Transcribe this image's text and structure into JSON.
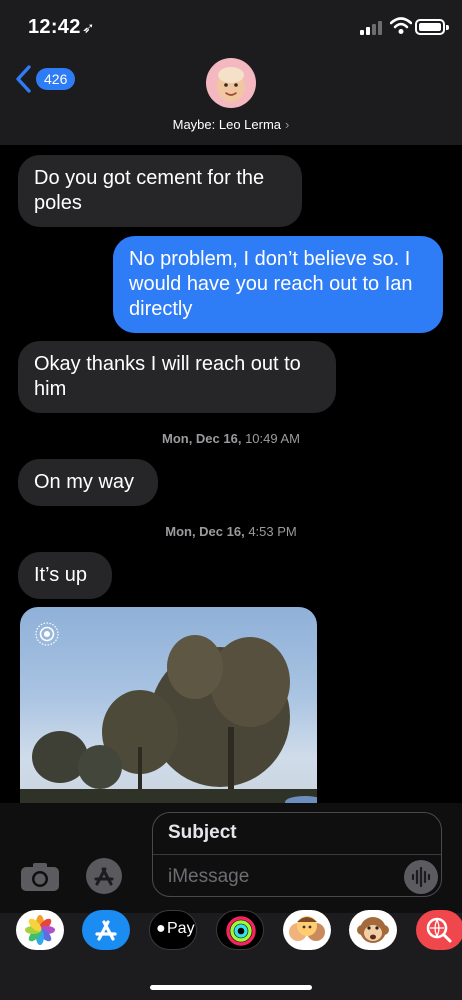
{
  "status_bar": {
    "time": "12:42"
  },
  "header": {
    "back_count": "426",
    "contact_name": "Maybe: Leo Lerma"
  },
  "messages": [
    {
      "direction": "incoming",
      "text": "Do you got cement for the poles"
    },
    {
      "direction": "outgoing",
      "text": "No problem, I don’t believe so. I would have you reach out to Ian directly"
    },
    {
      "direction": "incoming",
      "text": "Okay thanks I will reach out to him"
    },
    {
      "type": "timestamp",
      "day": "Mon, Dec 16,",
      "time": "10:49 AM"
    },
    {
      "direction": "incoming",
      "text": "On my way"
    },
    {
      "type": "timestamp",
      "day": "Mon, Dec 16,",
      "time": "4:53 PM"
    },
    {
      "direction": "incoming",
      "text": "It’s up"
    },
    {
      "direction": "incoming",
      "type": "photo",
      "subject": "trees-under-blue-sky"
    }
  ],
  "compose": {
    "subject_placeholder": "Subject",
    "message_placeholder": "iMessage"
  },
  "app_drawer": {
    "apps": [
      "photos-icon",
      "app-store-icon",
      "apple-pay-icon",
      "activity-icon",
      "memoji-icon",
      "animoji-monkey-icon",
      "web-search-icon"
    ],
    "apple_pay_label": "Pay"
  },
  "colors": {
    "outgoing_bubble": "#2e7cf6",
    "incoming_bubble": "#262628",
    "background": "#000000"
  }
}
